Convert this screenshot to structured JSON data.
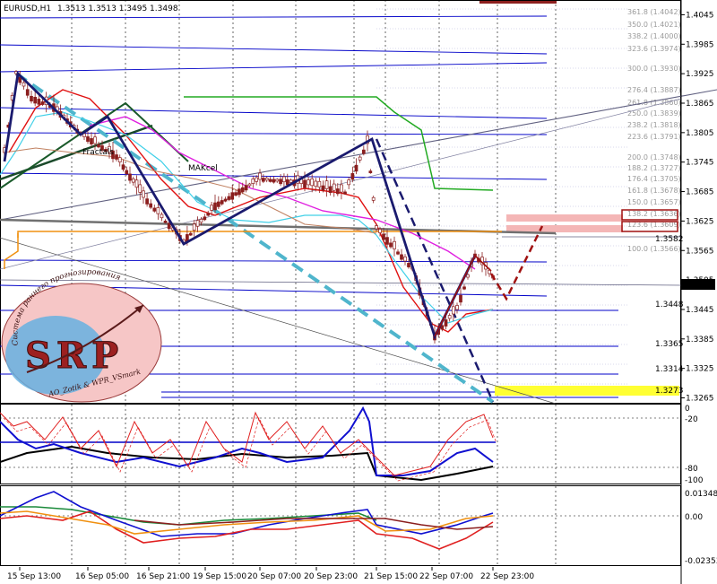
{
  "header": {
    "symbol_tf": "EURUSD,H1",
    "ohlc": "1.3513 1.3513 1.3495 1.3498"
  },
  "logo": {
    "arc_text": "Система раннего прогнозирования",
    "big_text": "SRP",
    "authors": "AO_Zotik & WPR_VSmark"
  },
  "annotations": {
    "fractal_text_1": "Fractals",
    "fractal_text_2": "MAKcel"
  },
  "price_axis": {
    "current_price": "1.3498",
    "marked_levels": [
      {
        "price": "1.3582",
        "color": "#0000c8"
      },
      {
        "price": "1.3448",
        "color": "#0000c8"
      },
      {
        "price": "1.3365",
        "color": "#0000c8"
      },
      {
        "price": "1.3314",
        "color": "#0000c8"
      },
      {
        "price": "1.3273",
        "color": "#000000",
        "bg": "#ffff33"
      }
    ]
  },
  "fib_labels": [
    "361.8 (1.4042)",
    "350.0 (1.4021)",
    "338.2 (1.4000)",
    "323.6 (1.3974)",
    "300.0 (1.3930)",
    "276.4 (1.3887)",
    "261.8 (1.3860)",
    "250.0 (1.3839)",
    "238.2 (1.3818)",
    "223.6 (1.3791)",
    "200.0 (1.3748)",
    "188.2 (1.3727)",
    "176.4 (1.3705)",
    "161.8 (1.3678)",
    "150.0 (1.3657)",
    "138.2 (1.3636)",
    "123.6 (1.3609)",
    "100.0 (1.3566)"
  ],
  "subwindow_1": {
    "upper": "-20",
    "lower": "-80",
    "bottom": "-100",
    "top_marker": "0"
  },
  "subwindow_2": {
    "upper": "0.01348",
    "zero": "0.00",
    "lower": "-0.02353"
  },
  "chart_data": {
    "type": "line",
    "symbol": "EURUSD",
    "timeframe": "H1",
    "x_ticks": [
      "15 Sep 13:00",
      "16 Sep 05:00",
      "16 Sep 21:00",
      "19 Sep 15:00",
      "20 Sep 07:00",
      "20 Sep 23:00",
      "21 Sep 15:00",
      "22 Sep 07:00",
      "22 Sep 23:00"
    ],
    "y_ticks": [
      1.4045,
      1.3985,
      1.3925,
      1.3865,
      1.3805,
      1.3745,
      1.3685,
      1.3625,
      1.3565,
      1.3505,
      1.3445,
      1.3385,
      1.3325,
      1.3265
    ],
    "ylim": [
      1.3255,
      1.4075
    ],
    "sub1_ylim": [
      -100,
      0
    ],
    "sub2_ylim": [
      -0.02353,
      0.01348
    ],
    "close_path": [
      [
        "15 Sep 13:00",
        1.374
      ],
      [
        "15 Sep 19:00",
        1.393
      ],
      [
        "16 Sep 05:00",
        1.384
      ],
      [
        "16 Sep 13:00",
        1.379
      ],
      [
        "16 Sep 21:00",
        1.366
      ],
      [
        "19 Sep 07:00",
        1.362
      ],
      [
        "19 Sep 15:00",
        1.36
      ],
      [
        "19 Sep 23:00",
        1.363
      ],
      [
        "20 Sep 07:00",
        1.372
      ],
      [
        "20 Sep 15:00",
        1.37
      ],
      [
        "20 Sep 23:00",
        1.368
      ],
      [
        "21 Sep 07:00",
        1.376
      ],
      [
        "21 Sep 09:00",
        1.379
      ],
      [
        "21 Sep 15:00",
        1.358
      ],
      [
        "22 Sep 00:00",
        1.352
      ],
      [
        "22 Sep 07:00",
        1.341
      ],
      [
        "22 Sep 15:00",
        1.347
      ],
      [
        "22 Sep 20:00",
        1.354
      ],
      [
        "22 Sep 23:00",
        1.3498
      ]
    ],
    "forecast_path": [
      [
        "22 Sep 23:00",
        1.3498
      ],
      [
        "23 Sep 03:00",
        1.347
      ],
      [
        "23 Sep 11:00",
        1.3615
      ]
    ],
    "zigzag_path": [
      [
        "15 Sep 17:00",
        1.3935
      ],
      [
        "16 Sep 21:00",
        1.359
      ],
      [
        "21 Sep 09:00",
        1.3795
      ],
      [
        "22 Sep 11:00",
        1.34
      ],
      [
        "22 Sep 17:00",
        1.3555
      ]
    ]
  },
  "colors": {
    "price_bar": "#8b1e1e",
    "zigzag": "#1a1a6e",
    "dashed_cyan": "#4fb5cc",
    "dashed_navy": "#1a1a6e",
    "forecast": "#a01010",
    "green_line": "#22aa22",
    "magenta_ma": "#e020e0",
    "red_ma": "#e01010",
    "cyan_ma": "#40d0e8",
    "orange_line": "#f09010",
    "gray_thick": "#707070",
    "blue_line": "#0000c8",
    "pink_zone": "#f4b6b6"
  }
}
